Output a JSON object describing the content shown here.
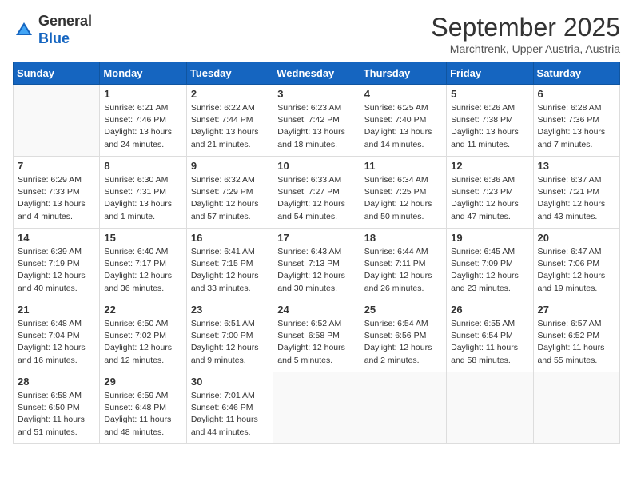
{
  "logo": {
    "general": "General",
    "blue": "Blue"
  },
  "header": {
    "month": "September 2025",
    "location": "Marchtrenk, Upper Austria, Austria"
  },
  "days_of_week": [
    "Sunday",
    "Monday",
    "Tuesday",
    "Wednesday",
    "Thursday",
    "Friday",
    "Saturday"
  ],
  "weeks": [
    [
      {
        "day": "",
        "info": ""
      },
      {
        "day": "1",
        "info": "Sunrise: 6:21 AM\nSunset: 7:46 PM\nDaylight: 13 hours\nand 24 minutes."
      },
      {
        "day": "2",
        "info": "Sunrise: 6:22 AM\nSunset: 7:44 PM\nDaylight: 13 hours\nand 21 minutes."
      },
      {
        "day": "3",
        "info": "Sunrise: 6:23 AM\nSunset: 7:42 PM\nDaylight: 13 hours\nand 18 minutes."
      },
      {
        "day": "4",
        "info": "Sunrise: 6:25 AM\nSunset: 7:40 PM\nDaylight: 13 hours\nand 14 minutes."
      },
      {
        "day": "5",
        "info": "Sunrise: 6:26 AM\nSunset: 7:38 PM\nDaylight: 13 hours\nand 11 minutes."
      },
      {
        "day": "6",
        "info": "Sunrise: 6:28 AM\nSunset: 7:36 PM\nDaylight: 13 hours\nand 7 minutes."
      }
    ],
    [
      {
        "day": "7",
        "info": "Sunrise: 6:29 AM\nSunset: 7:33 PM\nDaylight: 13 hours\nand 4 minutes."
      },
      {
        "day": "8",
        "info": "Sunrise: 6:30 AM\nSunset: 7:31 PM\nDaylight: 13 hours\nand 1 minute."
      },
      {
        "day": "9",
        "info": "Sunrise: 6:32 AM\nSunset: 7:29 PM\nDaylight: 12 hours\nand 57 minutes."
      },
      {
        "day": "10",
        "info": "Sunrise: 6:33 AM\nSunset: 7:27 PM\nDaylight: 12 hours\nand 54 minutes."
      },
      {
        "day": "11",
        "info": "Sunrise: 6:34 AM\nSunset: 7:25 PM\nDaylight: 12 hours\nand 50 minutes."
      },
      {
        "day": "12",
        "info": "Sunrise: 6:36 AM\nSunset: 7:23 PM\nDaylight: 12 hours\nand 47 minutes."
      },
      {
        "day": "13",
        "info": "Sunrise: 6:37 AM\nSunset: 7:21 PM\nDaylight: 12 hours\nand 43 minutes."
      }
    ],
    [
      {
        "day": "14",
        "info": "Sunrise: 6:39 AM\nSunset: 7:19 PM\nDaylight: 12 hours\nand 40 minutes."
      },
      {
        "day": "15",
        "info": "Sunrise: 6:40 AM\nSunset: 7:17 PM\nDaylight: 12 hours\nand 36 minutes."
      },
      {
        "day": "16",
        "info": "Sunrise: 6:41 AM\nSunset: 7:15 PM\nDaylight: 12 hours\nand 33 minutes."
      },
      {
        "day": "17",
        "info": "Sunrise: 6:43 AM\nSunset: 7:13 PM\nDaylight: 12 hours\nand 30 minutes."
      },
      {
        "day": "18",
        "info": "Sunrise: 6:44 AM\nSunset: 7:11 PM\nDaylight: 12 hours\nand 26 minutes."
      },
      {
        "day": "19",
        "info": "Sunrise: 6:45 AM\nSunset: 7:09 PM\nDaylight: 12 hours\nand 23 minutes."
      },
      {
        "day": "20",
        "info": "Sunrise: 6:47 AM\nSunset: 7:06 PM\nDaylight: 12 hours\nand 19 minutes."
      }
    ],
    [
      {
        "day": "21",
        "info": "Sunrise: 6:48 AM\nSunset: 7:04 PM\nDaylight: 12 hours\nand 16 minutes."
      },
      {
        "day": "22",
        "info": "Sunrise: 6:50 AM\nSunset: 7:02 PM\nDaylight: 12 hours\nand 12 minutes."
      },
      {
        "day": "23",
        "info": "Sunrise: 6:51 AM\nSunset: 7:00 PM\nDaylight: 12 hours\nand 9 minutes."
      },
      {
        "day": "24",
        "info": "Sunrise: 6:52 AM\nSunset: 6:58 PM\nDaylight: 12 hours\nand 5 minutes."
      },
      {
        "day": "25",
        "info": "Sunrise: 6:54 AM\nSunset: 6:56 PM\nDaylight: 12 hours\nand 2 minutes."
      },
      {
        "day": "26",
        "info": "Sunrise: 6:55 AM\nSunset: 6:54 PM\nDaylight: 11 hours\nand 58 minutes."
      },
      {
        "day": "27",
        "info": "Sunrise: 6:57 AM\nSunset: 6:52 PM\nDaylight: 11 hours\nand 55 minutes."
      }
    ],
    [
      {
        "day": "28",
        "info": "Sunrise: 6:58 AM\nSunset: 6:50 PM\nDaylight: 11 hours\nand 51 minutes."
      },
      {
        "day": "29",
        "info": "Sunrise: 6:59 AM\nSunset: 6:48 PM\nDaylight: 11 hours\nand 48 minutes."
      },
      {
        "day": "30",
        "info": "Sunrise: 7:01 AM\nSunset: 6:46 PM\nDaylight: 11 hours\nand 44 minutes."
      },
      {
        "day": "",
        "info": ""
      },
      {
        "day": "",
        "info": ""
      },
      {
        "day": "",
        "info": ""
      },
      {
        "day": "",
        "info": ""
      }
    ]
  ]
}
